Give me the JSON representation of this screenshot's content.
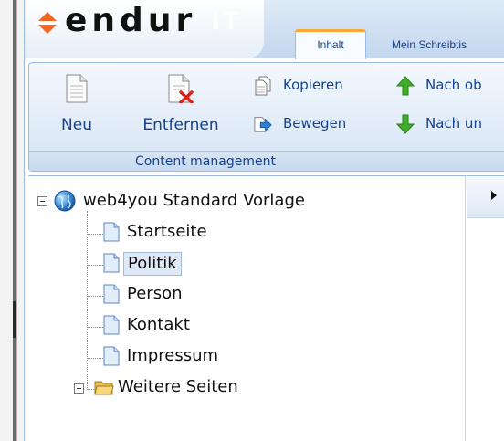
{
  "header": {
    "logo_text": "endur",
    "logo_suffix": "IT",
    "tabs": [
      {
        "label": "Inhalt",
        "active": true
      },
      {
        "label": "Mein Schreibtis"
      }
    ]
  },
  "toolbar": {
    "buttons": {
      "new": "Neu",
      "remove": "Entfernen",
      "copy": "Kopieren",
      "move": "Bewegen",
      "up": "Nach ob",
      "down": "Nach un"
    },
    "group_label": "Content management"
  },
  "tree": {
    "root": "web4you Standard Vorlage",
    "pages": [
      "Startseite",
      "Politik",
      "Person",
      "Kontakt",
      "Impressum"
    ],
    "selected": "Politik",
    "folder": "Weitere Seiten"
  },
  "colors": {
    "accent": "#15428b",
    "border": "#99bbe8",
    "logo_orange": "#f26522",
    "tab_highlight": "#f7a934"
  },
  "icons": [
    "logo-diamond-icon",
    "new-page-icon",
    "delete-page-icon",
    "copy-icon",
    "move-icon",
    "arrow-up-icon",
    "arrow-down-icon",
    "globe-icon",
    "page-icon",
    "folder-icon"
  ]
}
